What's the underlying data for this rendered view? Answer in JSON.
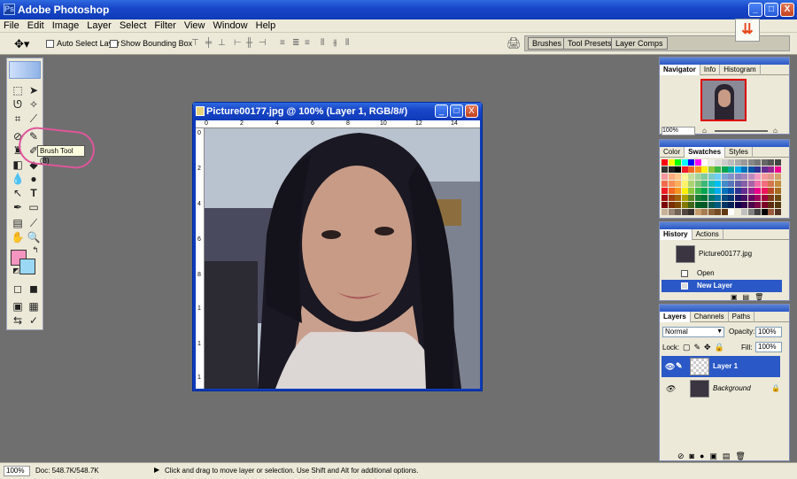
{
  "app": {
    "title": "Adobe Photoshop",
    "window_controls": {
      "minimize": "_",
      "maximize": "□",
      "close": "X"
    }
  },
  "menu": [
    "File",
    "Edit",
    "Image",
    "Layer",
    "Select",
    "Filter",
    "View",
    "Window",
    "Help"
  ],
  "options_bar": {
    "auto_select_label": "Auto Select Layer",
    "bounding_box_label": "Show Bounding Box",
    "well_tabs": [
      "Brushes",
      "Tool Presets",
      "Layer Comps"
    ]
  },
  "tooltip": "Brush Tool (B)",
  "colors": {
    "foreground": "#f495c0",
    "background": "#9ad8f4",
    "annotation": "#e0559a"
  },
  "document": {
    "title": "Picture00177.jpg @ 100% (Layer 1, RGB/8#)",
    "ruler_top": [
      "0",
      "2",
      "4",
      "6",
      "8",
      "10",
      "12",
      "14"
    ],
    "ruler_left": [
      "0",
      "2",
      "4",
      "6",
      "8",
      "1",
      "1",
      "1"
    ]
  },
  "navigator": {
    "tabs": [
      "Navigator",
      "Info",
      "Histogram"
    ],
    "zoom": "100%"
  },
  "swatches": {
    "tabs": [
      "Color",
      "Swatches",
      "Styles"
    ],
    "colors": [
      "#ff0000",
      "#ffff00",
      "#00ff00",
      "#00ffff",
      "#0000ff",
      "#ff00ff",
      "#ffffff",
      "#eeeeee",
      "#dddddd",
      "#cccccc",
      "#bbbbbb",
      "#aaaaaa",
      "#999999",
      "#888888",
      "#777777",
      "#666666",
      "#555555",
      "#444444",
      "#333333",
      "#222222",
      "#000000",
      "#ee1c24",
      "#f26522",
      "#f7941d",
      "#fff200",
      "#8dc63f",
      "#39b54a",
      "#00a651",
      "#00a99d",
      "#00aeef",
      "#0072bc",
      "#0054a6",
      "#2e3192",
      "#662d91",
      "#92278f",
      "#ec008c",
      "#f6989d",
      "#f9ad81",
      "#fdc68a",
      "#fff799",
      "#c4df9b",
      "#a3d39c",
      "#82ca9c",
      "#7accc8",
      "#6dcff6",
      "#7da7d9",
      "#8393ca",
      "#8781bd",
      "#a186be",
      "#bd8cbf",
      "#f49ac2",
      "#f5989d",
      "#e3998e",
      "#d2a36e",
      "#f26c4f",
      "#f68e55",
      "#fbaf5c",
      "#fff467",
      "#acd372",
      "#7cc576",
      "#3bb878",
      "#1abbb4",
      "#00bff3",
      "#438ccb",
      "#5574b9",
      "#605ca8",
      "#855fa8",
      "#a763a8",
      "#f06ea9",
      "#f26d7d",
      "#d4754f",
      "#c38c3e",
      "#ed1c24",
      "#f26522",
      "#f7941d",
      "#fff200",
      "#8dc73f",
      "#39b54a",
      "#00a651",
      "#00a99d",
      "#00aeef",
      "#0072bc",
      "#0054a6",
      "#2e3192",
      "#662d91",
      "#92278f",
      "#ec008c",
      "#ed145b",
      "#b84a26",
      "#a66c20",
      "#9e0b0f",
      "#a0410d",
      "#a3620a",
      "#aba000",
      "#598527",
      "#1a7b30",
      "#007236",
      "#00746b",
      "#0076a3",
      "#004b80",
      "#003471",
      "#1b1464",
      "#440e62",
      "#630460",
      "#9e005d",
      "#9e0039",
      "#7b3a16",
      "#6f4914",
      "#790000",
      "#7b2e00",
      "#7d4900",
      "#827b00",
      "#406618",
      "#005e20",
      "#005826",
      "#005952",
      "#005b7f",
      "#003663",
      "#002157",
      "#0d004c",
      "#32004b",
      "#4b0049",
      "#7b0046",
      "#7a0026",
      "#5e2b0e",
      "#54370c",
      "#c7b299",
      "#998675",
      "#736357",
      "#534741",
      "#37302d",
      "#c69c6d",
      "#a67c52",
      "#8c6239",
      "#754c24",
      "#603913",
      "#ffffff",
      "#ece9d8",
      "#c0c0c0",
      "#808080",
      "#404040",
      "#000000",
      "#9a5a3b",
      "#553322"
    ]
  },
  "history": {
    "tabs": [
      "History",
      "Actions"
    ],
    "snapshot": "Picture00177.jpg",
    "items": [
      "Open",
      "New Layer"
    ]
  },
  "layers": {
    "tabs": [
      "Layers",
      "Channels",
      "Paths"
    ],
    "blend_mode": "Normal",
    "opacity_label": "Opacity:",
    "opacity": "100%",
    "lock_label": "Lock:",
    "fill_label": "Fill:",
    "fill": "100%",
    "items": [
      "Layer 1",
      "Background"
    ]
  },
  "status": {
    "zoom": "100%",
    "doc": "Doc: 548.7K/548.7K",
    "message": "Click and drag to move layer or selection.  Use Shift and Alt for additional options."
  }
}
